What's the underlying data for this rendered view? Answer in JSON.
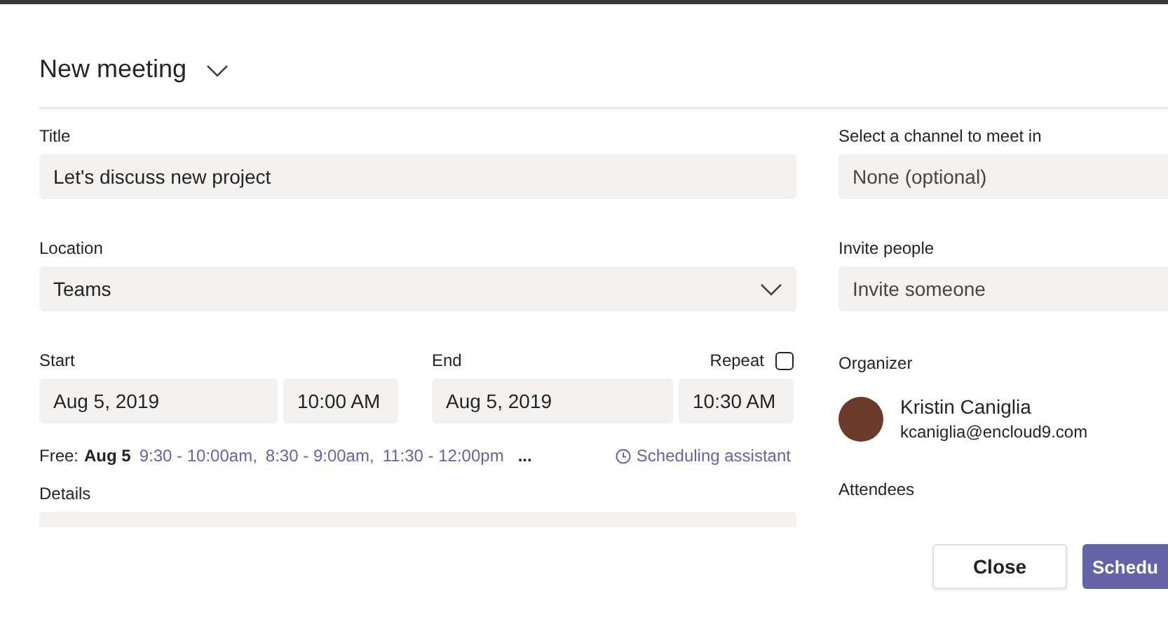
{
  "dialog": {
    "title": "New meeting"
  },
  "left": {
    "title": {
      "label": "Title",
      "value": "Let's discuss new project"
    },
    "location": {
      "label": "Location",
      "value": "Teams"
    },
    "start": {
      "label": "Start",
      "date": "Aug 5, 2019",
      "time": "10:00 AM"
    },
    "end": {
      "label": "End",
      "date": "Aug 5, 2019",
      "time": "10:30 AM"
    },
    "repeat": {
      "label": "Repeat",
      "checked": false
    },
    "free": {
      "label": "Free:",
      "date": "Aug 5",
      "slots": [
        "9:30 - 10:00am,",
        "8:30 - 9:00am,",
        "11:30 - 12:00pm"
      ],
      "more": "..."
    },
    "scheduling_assistant": "Scheduling assistant",
    "details": {
      "label": "Details"
    }
  },
  "right": {
    "channel": {
      "label": "Select a channel to meet in",
      "placeholder": "None (optional)"
    },
    "invite": {
      "label": "Invite people",
      "placeholder": "Invite someone"
    },
    "organizer": {
      "label": "Organizer",
      "name": "Kristin Caniglia",
      "email": "kcaniglia@encloud9.com"
    },
    "attendees": {
      "label": "Attendees"
    }
  },
  "buttons": [
    {
      "label": "Close",
      "kind": "secondary"
    },
    {
      "label": "Schedu",
      "kind": "primary"
    }
  ]
}
